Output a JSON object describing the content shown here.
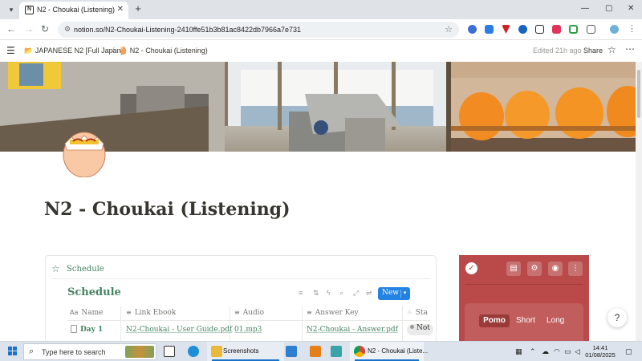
{
  "browser": {
    "tab_title": "N2 - Choukai (Listening)",
    "tab_favicon": "N",
    "close_tab": "✕",
    "new_tab": "+",
    "url": "notion.so/N2-Choukai-Listening-2410ffe51b3b81ac8422db7966a7e731",
    "window_controls": [
      "—",
      "▢",
      "✕"
    ]
  },
  "notion": {
    "breadcrumb": [
      {
        "icon": "📂",
        "label": "JAPANESE N2 [Full Japan]"
      },
      {
        "icon": "🥚",
        "label": "N2 - Choukai (Listening)"
      }
    ],
    "edited": "Edited 21h ago",
    "share": "Share",
    "page_title": "N2 - Choukai (Listening)",
    "schedule_heading": "Schedule",
    "database": {
      "title": "Schedule",
      "new_label": "New",
      "columns": [
        {
          "icon": "Aa",
          "label": "Name"
        },
        {
          "icon": "≡",
          "label": "Link Ebook"
        },
        {
          "icon": "≡",
          "label": "Audio"
        },
        {
          "icon": "≡",
          "label": "Answer Key"
        },
        {
          "icon": "⁘",
          "label": "Sta"
        }
      ],
      "rows": [
        {
          "name": "Day 1",
          "ebook": "N2-Choukai - User Guide.pdf",
          "audio": "01.mp3",
          "answer": "N2-Choukai - Answer.pdf",
          "status": "Not"
        }
      ]
    }
  },
  "pomodoro": {
    "modes": [
      "Pomo",
      "Short",
      "Long"
    ],
    "accent": "#b94a49"
  },
  "help_icon": "?",
  "taskbar": {
    "search_placeholder": "Type here to search",
    "apps": [
      {
        "label": "Screenshots"
      },
      {
        "label": "N2 - Choukai (Liste..."
      }
    ],
    "time": "14:41",
    "date": "01/08/2025"
  }
}
